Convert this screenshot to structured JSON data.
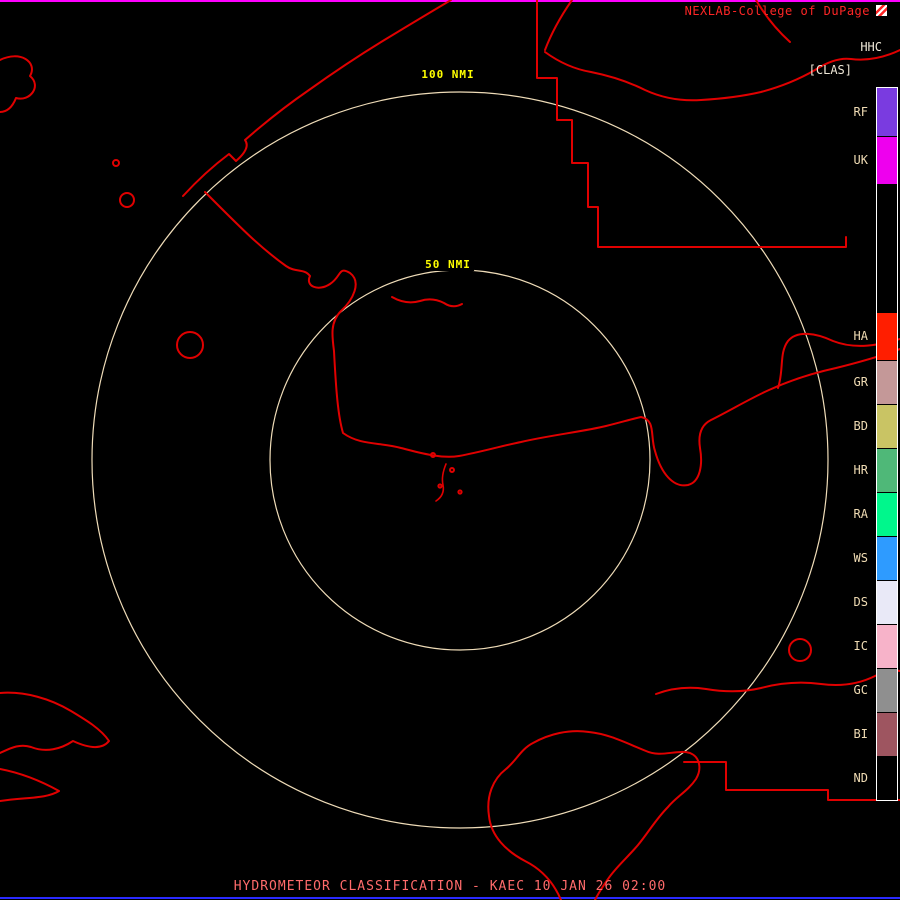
{
  "header": {
    "brand": "NEXLAB-College of DuPage",
    "product_code": "HHC",
    "classification": "[CLAS]"
  },
  "rings": {
    "inner_label": "50 NMI",
    "outer_label": "100 NMI"
  },
  "legend": {
    "segments": [
      {
        "label": "RF",
        "color": "#7a3be0",
        "height": 48
      },
      {
        "label": "UK",
        "color": "#ee00ee",
        "height": 48
      },
      {
        "label": "",
        "color": "#000000",
        "height": 128
      },
      {
        "label": "HA",
        "color": "#ff1e00",
        "height": 48
      },
      {
        "label": "GR",
        "color": "#c49898",
        "height": 44
      },
      {
        "label": "BD",
        "color": "#c9c464",
        "height": 44
      },
      {
        "label": "HR",
        "color": "#4fb878",
        "height": 44
      },
      {
        "label": "RA",
        "color": "#00f78c",
        "height": 44
      },
      {
        "label": "WS",
        "color": "#2e9bff",
        "height": 44
      },
      {
        "label": "DS",
        "color": "#e9e9f7",
        "height": 44
      },
      {
        "label": "IC",
        "color": "#f7b3c9",
        "height": 44
      },
      {
        "label": "GC",
        "color": "#8f8f8f",
        "height": 44
      },
      {
        "label": "BI",
        "color": "#9e5560",
        "height": 44
      },
      {
        "label": "ND",
        "color": "#000000",
        "height": 44
      }
    ]
  },
  "footer": {
    "title": "HYDROMETEOR CLASSIFICATION - KAEC 10 JAN 26 02:00"
  },
  "colors": {
    "background": "#000000",
    "map_line": "#e00000",
    "ring": "#efdcb8",
    "ring_label": "#ffff00",
    "brand_text": "#ff2626",
    "header_label": "#efe8d8",
    "legend_label": "#f0dcb4",
    "legend_border": "#ffffff",
    "footer_text": "#ff6b6b",
    "top_border": "#ff00ff",
    "bottom_border": "#2a2aff"
  }
}
